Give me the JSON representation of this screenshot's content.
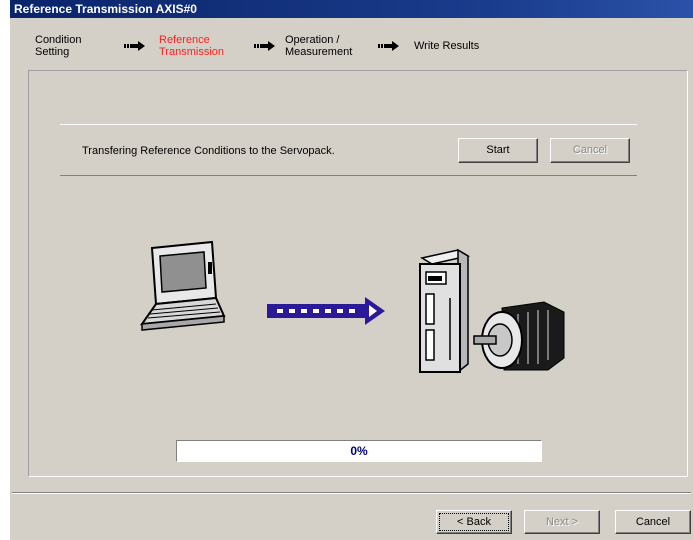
{
  "window": {
    "title": "Reference Transmission AXIS#0"
  },
  "steps": [
    {
      "label_line1": "Condition",
      "label_line2": "Setting"
    },
    {
      "label_line1": "Reference",
      "label_line2": "Transmission"
    },
    {
      "label_line1": "Operation /",
      "label_line2": "Measurement"
    },
    {
      "label_line1": "Write Results",
      "label_line2": ""
    }
  ],
  "active_step_color": "#ff2020",
  "transfer": {
    "message": "Transfering Reference Conditions to the Servopack.",
    "start_label": "Start",
    "cancel_label": "Cancel"
  },
  "progress": {
    "value": 0,
    "label": "0%"
  },
  "footer": {
    "back_label": "< Back",
    "next_label": "Next >",
    "cancel_label": "Cancel"
  },
  "icons": [
    "laptop-icon",
    "transfer-arrow-icon",
    "servopack-icon",
    "servomotor-icon"
  ]
}
